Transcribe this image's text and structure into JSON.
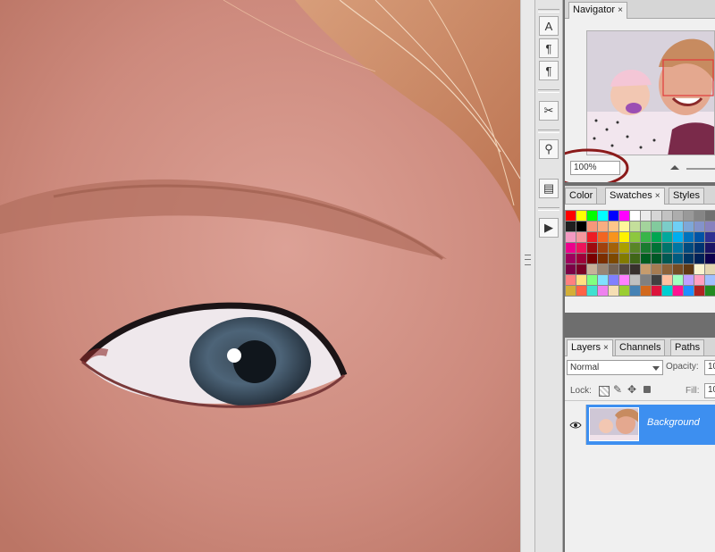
{
  "toolbar_icons": [
    "type-icon",
    "paragraph-icon",
    "character-style-icon",
    "tools-icon",
    "clone-source-icon",
    "layer-comps-icon",
    "actions-play-icon"
  ],
  "navigator": {
    "tab_label": "Navigator",
    "close_glyph": "×",
    "zoom_value": "100%",
    "annotation_color": "#8b1a1a",
    "view_box_color": "#e23b3b"
  },
  "color_panel": {
    "tabs": [
      {
        "label": "Color",
        "active": false
      },
      {
        "label": "Swatches",
        "active": true,
        "close": "×"
      },
      {
        "label": "Styles",
        "active": false
      }
    ],
    "swatches": [
      "#ff0000",
      "#ffff00",
      "#00ff00",
      "#00ffff",
      "#0000ff",
      "#ff00ff",
      "#ffffff",
      "#ebebeb",
      "#d6d6d6",
      "#c2c2c2",
      "#adadad",
      "#999999",
      "#858585",
      "#707070",
      "#5c5c5c",
      "#474747",
      "#1f1f1f",
      "#000000",
      "#f7977a",
      "#f9ad81",
      "#fdc68a",
      "#fff79a",
      "#c4df9b",
      "#a3d39c",
      "#82ca9d",
      "#7bcdc8",
      "#6ecff6",
      "#7ea7d8",
      "#8493ca",
      "#8882be",
      "#a187be",
      "#bc8dbf",
      "#f49ac2",
      "#f6989d",
      "#ed1c24",
      "#f26522",
      "#f7941d",
      "#fff200",
      "#8dc73f",
      "#39b54a",
      "#00a651",
      "#00a99d",
      "#00aeef",
      "#0072bc",
      "#0054a6",
      "#2e3192",
      "#662d91",
      "#92278f",
      "#ec008c",
      "#ed145b",
      "#9e0b0f",
      "#a0410d",
      "#a36209",
      "#aba000",
      "#598527",
      "#1a7b30",
      "#007236",
      "#00746b",
      "#0076a3",
      "#004b80",
      "#003471",
      "#1b1464",
      "#440e62",
      "#630460",
      "#9e005d",
      "#9e0039",
      "#790000",
      "#7b2e00",
      "#7d4900",
      "#827b00",
      "#406618",
      "#005e20",
      "#005826",
      "#005952",
      "#005b7f",
      "#003663",
      "#002157",
      "#0d004c",
      "#32004b",
      "#4b0049",
      "#7b0046",
      "#7a0026",
      "#c7b299",
      "#998675",
      "#736357",
      "#534741",
      "#37302d",
      "#c69c6d",
      "#a67c52",
      "#8c6239",
      "#754c24",
      "#603913",
      "#f9f4cf",
      "#e3d6b0",
      "#6b8e23",
      "#808000",
      "#ff8080",
      "#ffe080",
      "#80ff80",
      "#80e0ff",
      "#8080ff",
      "#ff80ff",
      "#c0c0c0",
      "#808080",
      "#404040",
      "#ffc0a0",
      "#a0ffc0",
      "#c0a0ff",
      "#ffa0c0",
      "#a0c0ff",
      "#c0ffa0",
      "#e0e0a0",
      "#d4af37",
      "#ff6347",
      "#40e0d0",
      "#ee82ee",
      "#f5deb3",
      "#9acd32",
      "#4682b4",
      "#d2691e",
      "#dc143c",
      "#00ced1",
      "#ff1493",
      "#1e90ff",
      "#b22222",
      "#228b22",
      "#daa520",
      "#4b0082"
    ]
  },
  "layers_panel": {
    "tabs": [
      {
        "label": "Layers",
        "active": true,
        "close": "×"
      },
      {
        "label": "Channels",
        "active": false
      },
      {
        "label": "Paths",
        "active": false
      }
    ],
    "blend_mode": "Normal",
    "opacity_label": "Opacity:",
    "opacity_value": "10",
    "lock_label": "Lock:",
    "fill_label": "Fill:",
    "fill_value": "10",
    "layers": [
      {
        "name": "Background",
        "selected": true
      }
    ]
  }
}
